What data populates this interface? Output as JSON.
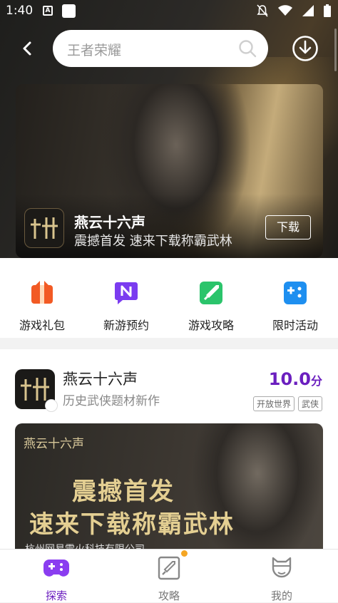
{
  "status_bar": {
    "time": "1:40",
    "app_icon_glyph": "A"
  },
  "search": {
    "placeholder": "王者荣耀"
  },
  "banner": {
    "title": "燕云十六声",
    "subtitle": "震撼首发  速来下载称霸武林",
    "button": "下载"
  },
  "quick_entries": [
    {
      "label": "游戏礼包",
      "icon": "gift-icon",
      "color": "#f25a24"
    },
    {
      "label": "新游预约",
      "icon": "n-badge-icon",
      "color": "#7b3cf0"
    },
    {
      "label": "游戏攻略",
      "icon": "sword-icon",
      "color": "#2bc46b"
    },
    {
      "label": "限时活动",
      "icon": "gamepad-icon",
      "color": "#1e8ff0"
    }
  ],
  "game": {
    "name": "燕云十六声",
    "description": "历史武侠题材新作",
    "score": "10.0",
    "score_unit": "分",
    "tags": [
      "开放世界",
      "武侠"
    ]
  },
  "promo": {
    "brand": "燕云十六声",
    "line1": "震撼首发",
    "line2": "速来下载称霸武林",
    "company": "杭州网易雷火科技有限公司"
  },
  "tabs": [
    {
      "label": "探索",
      "active": true
    },
    {
      "label": "攻略",
      "active": false
    },
    {
      "label": "我的",
      "active": false
    }
  ],
  "colors": {
    "accent": "#6b1fbf",
    "badge_dot": "#f5a623"
  }
}
